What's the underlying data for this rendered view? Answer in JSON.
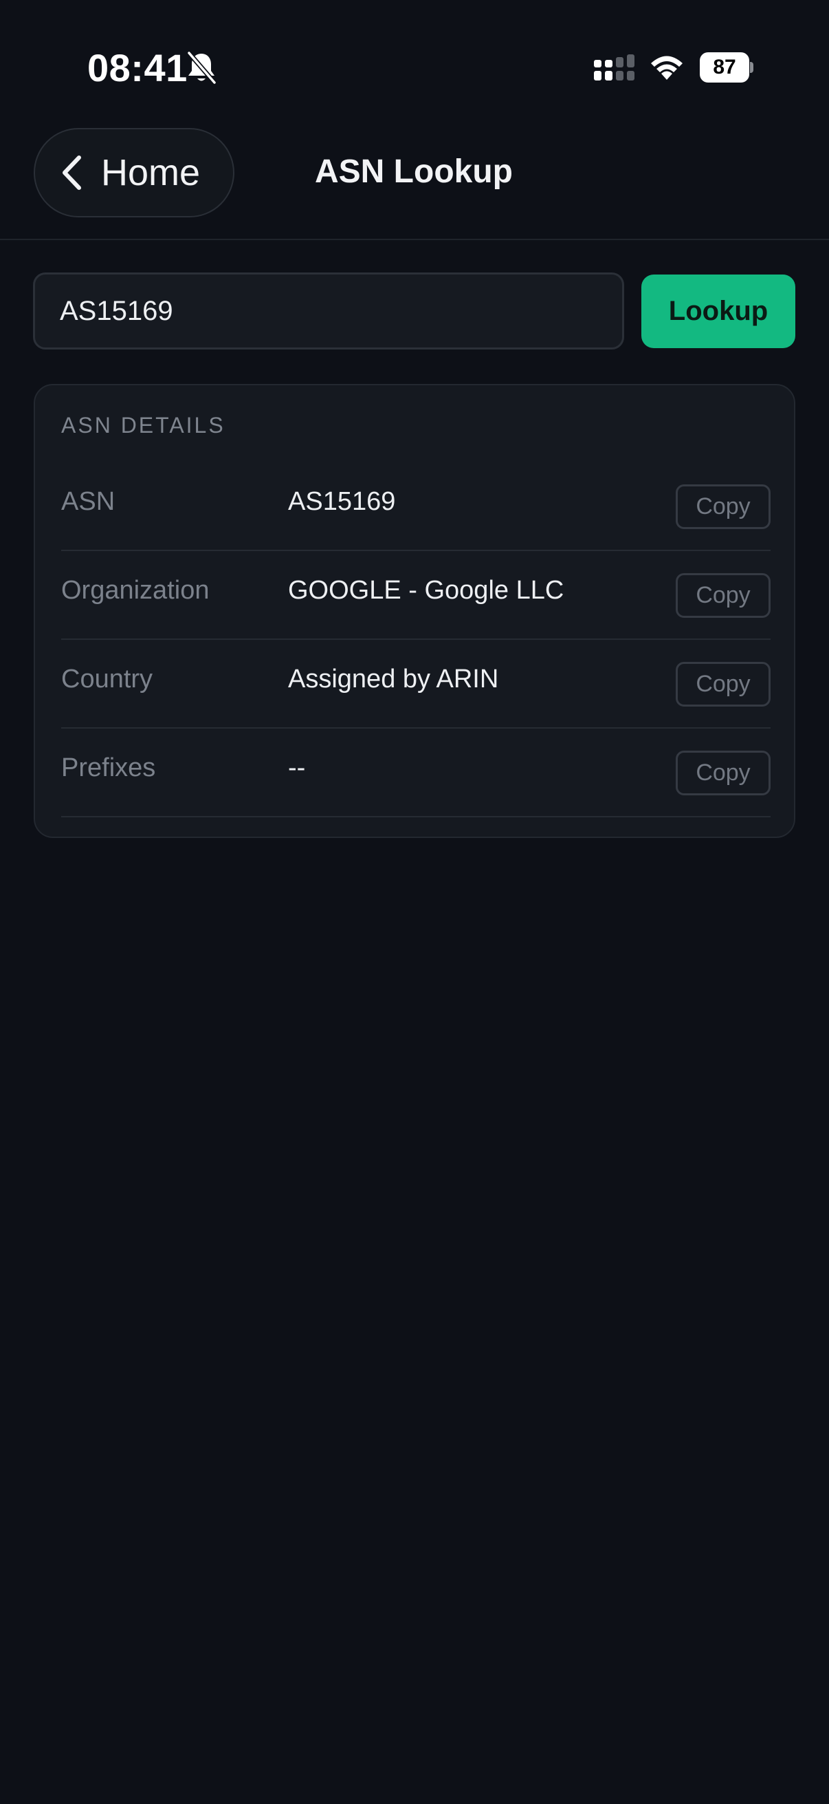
{
  "status_bar": {
    "time": "08:41",
    "battery": "87",
    "icons": [
      "bell-slash-icon",
      "cellular-signal-icon",
      "wifi-icon",
      "battery-icon"
    ]
  },
  "nav": {
    "back_label": "Home",
    "title": "ASN Lookup"
  },
  "search": {
    "value": "AS15169",
    "button_label": "Lookup"
  },
  "details": {
    "heading": "ASN DETAILS",
    "rows": [
      {
        "label": "ASN",
        "value": "AS15169",
        "action": "Copy"
      },
      {
        "label": "Organization",
        "value": "GOOGLE - Google LLC",
        "action": "Copy"
      },
      {
        "label": "Country",
        "value": "Assigned by ARIN",
        "action": "Copy"
      },
      {
        "label": "Prefixes",
        "value": "--",
        "action": "Copy"
      }
    ]
  },
  "colors": {
    "background": "#0d1017",
    "accent": "#13b981",
    "card": "#151920"
  }
}
